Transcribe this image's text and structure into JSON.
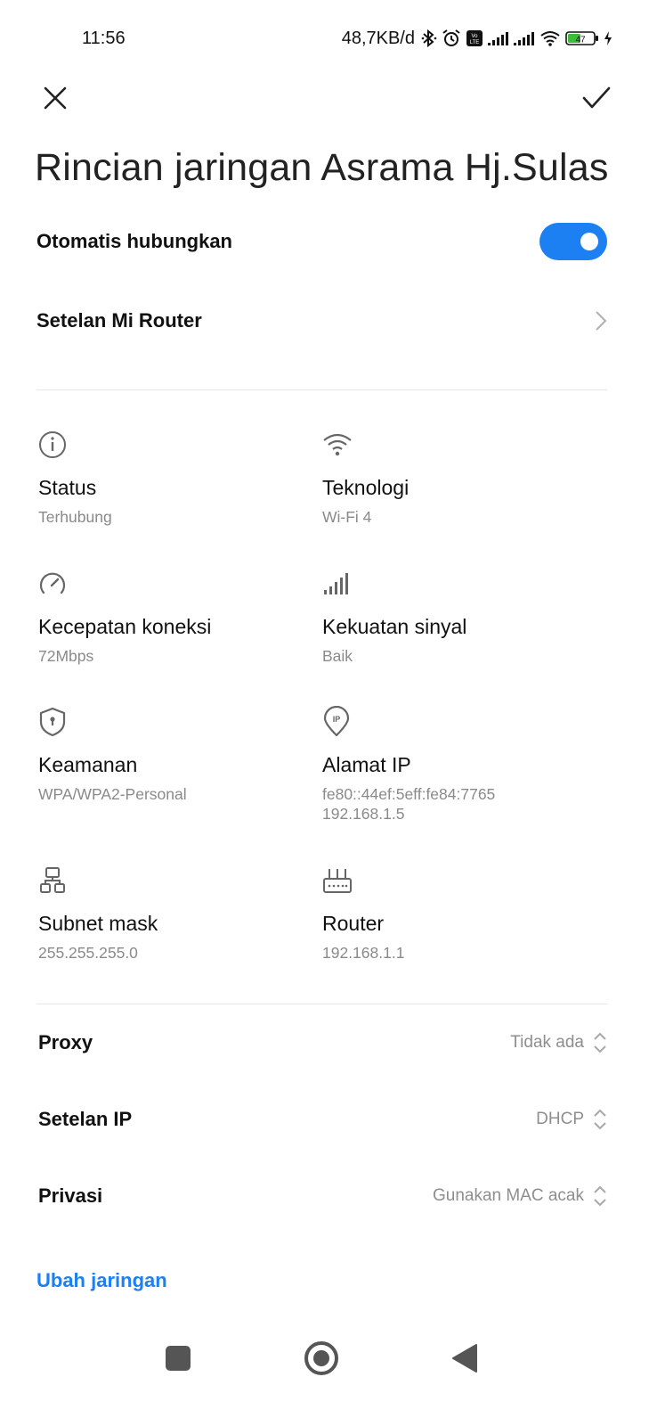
{
  "status_bar": {
    "time": "11:56",
    "net_speed": "48,7KB/d",
    "battery_level": "47",
    "icons": [
      "bluetooth-icon",
      "alarm-icon",
      "volte-icon",
      "signal-icon",
      "signal-icon",
      "wifi-icon",
      "battery-icon",
      "charging-icon"
    ]
  },
  "header": {
    "close_icon": "close-icon",
    "confirm_icon": "check-icon",
    "title": "Rincian jaringan Asrama Hj.Sulas"
  },
  "auto_connect": {
    "label": "Otomatis hubungkan",
    "enabled": true,
    "accent": "#1c7ff2"
  },
  "mi_router": {
    "label": "Setelan Mi Router"
  },
  "details": [
    {
      "icon": "info-icon",
      "title": "Status",
      "value": "Terhubung"
    },
    {
      "icon": "wifi-icon",
      "title": "Teknologi",
      "value": "Wi-Fi 4"
    },
    {
      "icon": "speedometer-icon",
      "title": "Kecepatan koneksi",
      "value": "72Mbps"
    },
    {
      "icon": "signal-strength-icon",
      "title": "Kekuatan sinyal",
      "value": "Baik"
    },
    {
      "icon": "shield-icon",
      "title": "Keamanan",
      "value": "WPA/WPA2-Personal"
    },
    {
      "icon": "ip-location-icon",
      "title": "Alamat IP",
      "value": "fe80::44ef:5eff:fe84:7765",
      "value2": "192.168.1.5"
    },
    {
      "icon": "network-topology-icon",
      "title": "Subnet mask",
      "value": "255.255.255.0"
    },
    {
      "icon": "router-icon",
      "title": "Router",
      "value": "192.168.1.1"
    }
  ],
  "settings": [
    {
      "label": "Proxy",
      "value": "Tidak ada"
    },
    {
      "label": "Setelan IP",
      "value": "DHCP"
    },
    {
      "label": "Privasi",
      "value": "Gunakan MAC acak"
    }
  ],
  "edit_network": {
    "label": "Ubah jaringan"
  },
  "nav": {
    "recents_icon": "square-icon",
    "home_icon": "circle-home-icon",
    "back_icon": "triangle-back-icon"
  }
}
